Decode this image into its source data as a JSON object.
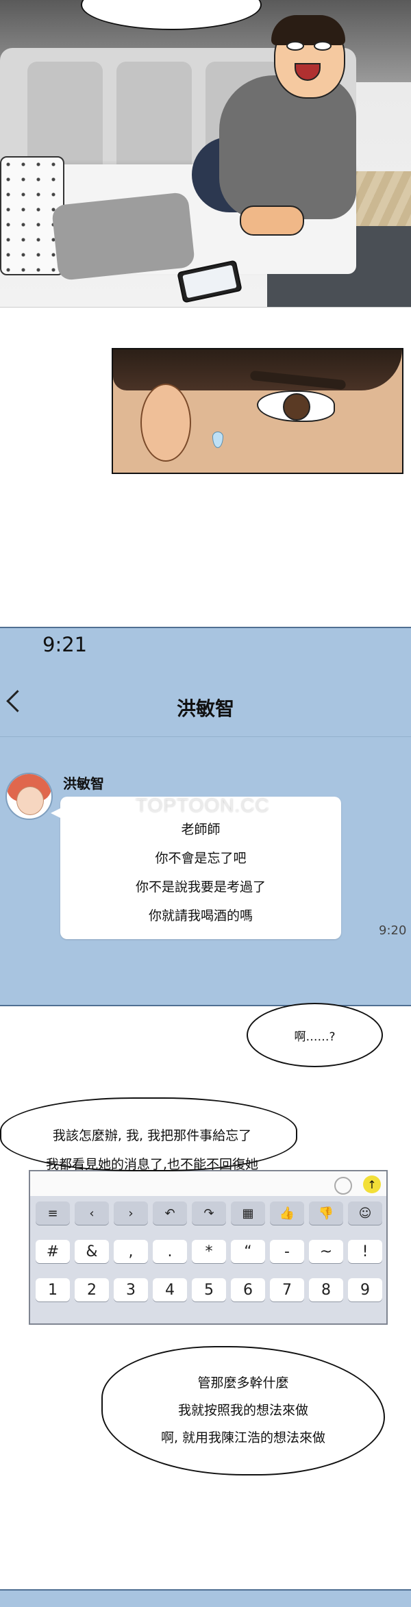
{
  "chat": {
    "status_time": "9:21",
    "contact_name": "洪敏智",
    "sender_name": "洪敏智",
    "watermark": "TOPTOON.CC",
    "message_lines": [
      "老師師",
      "你不會是忘了吧",
      "你不是說我要是考過了",
      "你就請我喝酒的嗎"
    ],
    "message_time": "9:20"
  },
  "thought": {
    "text": "啊……?"
  },
  "speech1": {
    "lines": [
      "我該怎麼辦, 我, 我把那件事給忘了",
      "我都看見她的消息了,也不能不回復她"
    ]
  },
  "keyboard": {
    "send_icon": "↑",
    "row1": [
      "≡",
      "‹",
      "›",
      "↶",
      "↷",
      "▦",
      "👍",
      "👎",
      "☺"
    ],
    "row2": [
      "#",
      "&",
      ",",
      ".",
      "*",
      "“",
      "-",
      "~",
      "!"
    ],
    "row3": [
      "1",
      "2",
      "3",
      "4",
      "5",
      "6",
      "7",
      "8",
      "9"
    ]
  },
  "speech2": {
    "lines": [
      "管那麼多幹什麼",
      "我就按照我的想法來做",
      "啊, 就用我陳江浩的想法來做"
    ]
  }
}
